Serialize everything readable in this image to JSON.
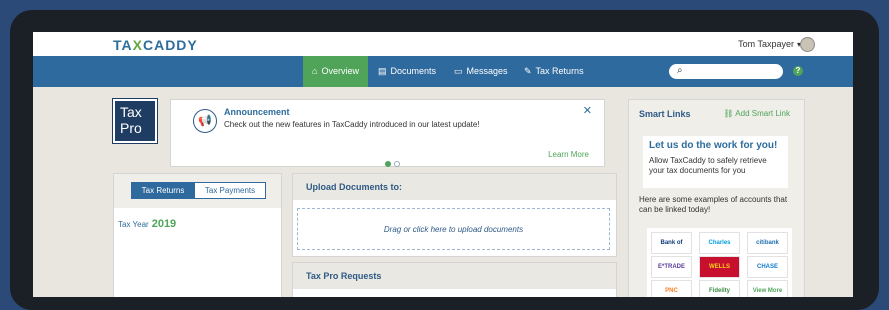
{
  "app": {
    "logo_left": "TA",
    "logo_x": "X",
    "logo_right": "CADDY",
    "user_name": "Tom Taxpayer",
    "user_chevron": "▾"
  },
  "nav": {
    "items": [
      {
        "label": "Overview",
        "icon": "home-icon",
        "glyph": "⌂"
      },
      {
        "label": "Documents",
        "icon": "documents-icon",
        "glyph": "▤"
      },
      {
        "label": "Messages",
        "icon": "messages-icon",
        "glyph": "▭"
      },
      {
        "label": "Tax Returns",
        "icon": "tax-returns-icon",
        "glyph": "✎"
      }
    ],
    "search_icon": "⌕",
    "help_label": "?"
  },
  "taxpro": {
    "line1": "Tax",
    "line2": "Pro"
  },
  "announcement": {
    "title": "Announcement",
    "text": "Check out the new features in TaxCaddy introduced in our latest update!",
    "close": "✕",
    "learn_more": "Learn More",
    "icon_glyph": "📢"
  },
  "left_panel": {
    "tabs": [
      {
        "label": "Tax Returns"
      },
      {
        "label": "Tax Payments"
      }
    ],
    "tax_year_label": "Tax Year",
    "tax_year_value": "2019"
  },
  "upload": {
    "title": "Upload Documents to:",
    "drop_text": "Drag or click here to upload documents"
  },
  "requests": {
    "title": "Tax Pro Requests"
  },
  "smart_links": {
    "title": "Smart Links",
    "add_label": "Add Smart Link",
    "card_heading": "Let us do the work for you!",
    "card_text": "Allow TaxCaddy to safely retrieve your tax documents for you",
    "examples_text": "Here are some examples of accounts that can be linked today!",
    "banks": [
      "Bank of America",
      "Charles Schwab",
      "citibank",
      "E*TRADE",
      "WELLS FARGO",
      "CHASE",
      "PNC",
      "Fidelity",
      "View More"
    ]
  },
  "colors": {
    "brand_blue": "#2f6a9e",
    "brand_green": "#4fa45a",
    "navy": "#1f3d63"
  }
}
